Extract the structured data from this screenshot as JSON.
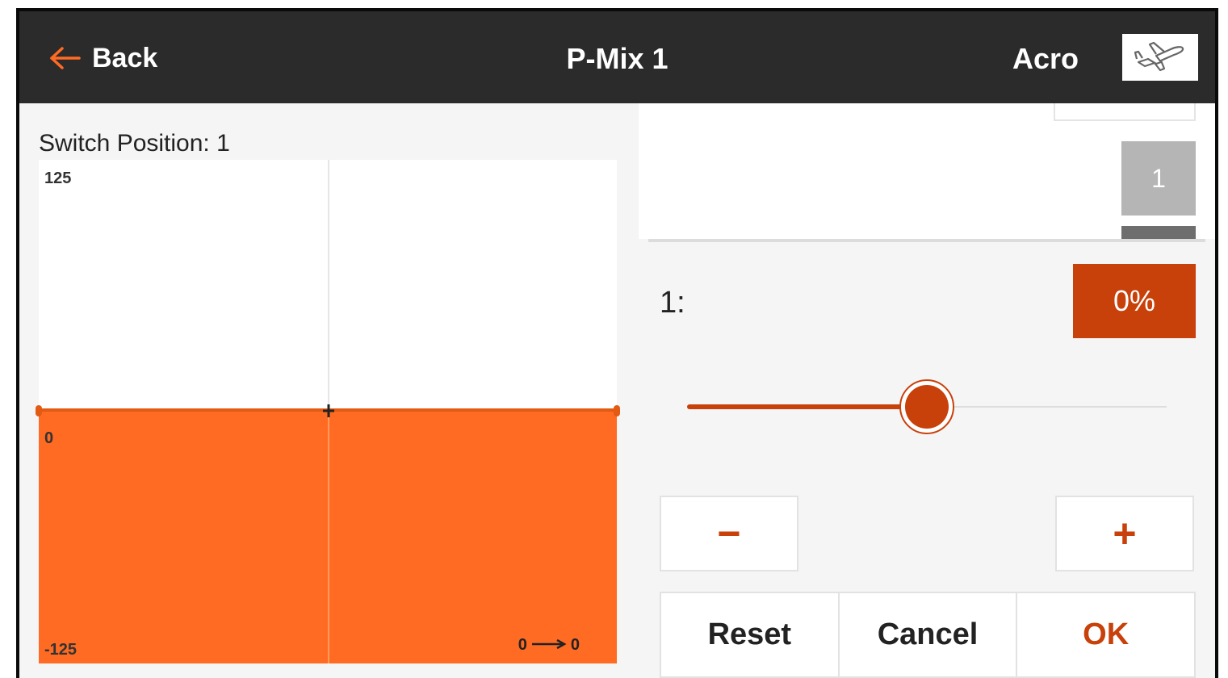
{
  "header": {
    "back_label": "Back",
    "title": "P-Mix 1",
    "model_type": "Acro",
    "model_icon": "airplane-icon"
  },
  "graph": {
    "switch_position_label": "Switch Position: 1",
    "y_max_label": "125",
    "y_zero_label": "0",
    "y_min_label": "-125",
    "input_value": "0",
    "output_value": "0",
    "arrow_icon": "right-arrow-icon",
    "fill_color": "#ff6b22"
  },
  "positions": {
    "selected_label": "1"
  },
  "editor": {
    "value_label": "1:",
    "value_display": "0%",
    "slider_value_fraction": 0.5,
    "minus_label": "−",
    "plus_label": "+"
  },
  "actions": {
    "reset_label": "Reset",
    "cancel_label": "Cancel",
    "ok_label": "OK"
  },
  "colors": {
    "accent": "#c8400a",
    "header_bg": "#2b2b2b",
    "back_arrow": "#ff6b22"
  }
}
